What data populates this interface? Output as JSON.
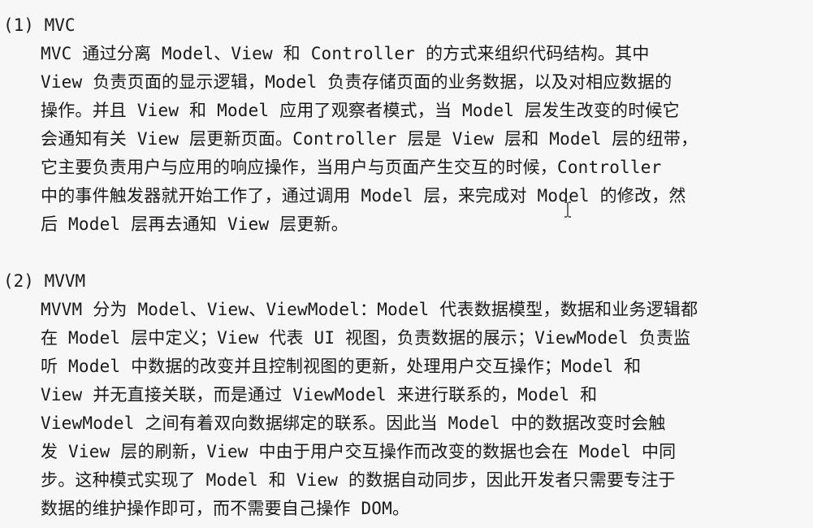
{
  "sections": [
    {
      "heading": "(1) MVC",
      "lines": [
        "MVC 通过分离 Model、View 和 Controller 的方式来组织代码结构。其中",
        "View 负责页面的显示逻辑，Model 负责存储页面的业务数据，以及对相应数据的",
        "操作。并且 View 和 Model 应用了观察者模式，当 Model 层发生改变的时候它",
        "会通知有关 View 层更新页面。Controller 层是 View 层和 Model 层的纽带，",
        "它主要负责用户与应用的响应操作，当用户与页面产生交互的时候，Controller",
        "中的事件触发器就开始工作了，通过调用 Model 层，来完成对 Model 的修改，然",
        "后 Model 层再去通知 View 层更新。"
      ]
    },
    {
      "heading": "(2) MVVM",
      "lines": [
        "MVVM 分为 Model、View、ViewModel：Model 代表数据模型，数据和业务逻辑都",
        "在 Model 层中定义；View 代表 UI 视图，负责数据的展示；ViewModel 负责监",
        "听 Model 中数据的改变并且控制视图的更新，处理用户交互操作；Model 和",
        "View 并无直接关联，而是通过 ViewModel 来进行联系的，Model 和",
        "ViewModel 之间有着双向数据绑定的联系。因此当 Model 中的数据改变时会触",
        "发 View 层的刷新，View 中由于用户交互操作而改变的数据也会在 Model 中同",
        "步。这种模式实现了 Model 和 View 的数据自动同步，因此开发者只需要专注于",
        "数据的维护操作即可，而不需要自己操作 DOM。"
      ]
    }
  ],
  "icons": {
    "cursor": "text-cursor-icon"
  }
}
